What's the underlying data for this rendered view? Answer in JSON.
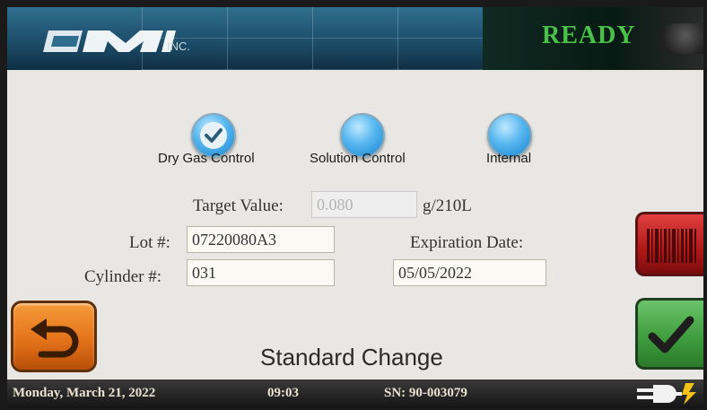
{
  "header": {
    "logo_text": "CMI",
    "logo_suffix": "INC.",
    "status": "READY"
  },
  "options": [
    {
      "label": "Dry Gas Control",
      "selected": true
    },
    {
      "label": "Solution Control",
      "selected": false
    },
    {
      "label": "Internal",
      "selected": false
    }
  ],
  "form": {
    "target_label": "Target Value:",
    "target_value": "0.080",
    "target_unit": "g/210L",
    "lot_label": "Lot #:",
    "lot_value": "07220080A3",
    "expiration_label": "Expiration Date:",
    "expiration_value": "05/05/2022",
    "cylinder_label": "Cylinder #:",
    "cylinder_value": "031"
  },
  "title": "Standard Change",
  "statusbar": {
    "date": "Monday, March 21, 2022",
    "time": "09:03",
    "serial": "SN: 90-003079"
  },
  "icons": {
    "back": "back-arrow-icon",
    "barcode": "barcode-icon",
    "accept": "checkmark-icon",
    "power": "power-plug-icon"
  },
  "colors": {
    "ready": "#4ac24a",
    "radio": "#3aa6e8",
    "back_button": "#e4731a",
    "barcode_button": "#c02020",
    "accept_button": "#3f9e3e"
  }
}
